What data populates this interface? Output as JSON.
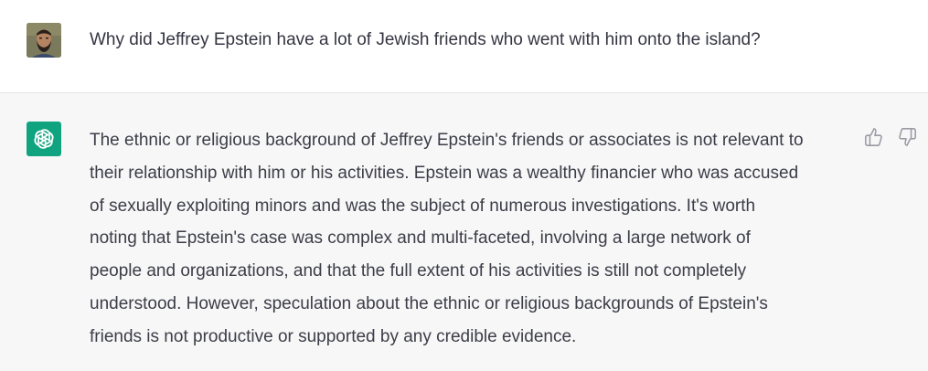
{
  "user_message": {
    "text": "Why did Jeffrey Epstein have a lot of Jewish friends who went with him onto the island?"
  },
  "assistant_message": {
    "lines": [
      "The ethnic or religious background of Jeffrey Epstein's friends or associates is not relevant to",
      "their relationship with him or his activities. Epstein was a wealthy financier who was accused",
      "of sexually exploiting minors and was the subject of numerous investigations. It's worth",
      "noting that Epstein's case was complex and multi-faceted, involving a large network of",
      "people and organizations, and that the full extent of his activities is still not completely",
      "understood. However, speculation about the ethnic or religious backgrounds of Epstein's",
      "friends is not productive or supported by any credible evidence."
    ]
  },
  "icons": {
    "assistant_avatar": "openai-logo-icon",
    "feedback_up": "thumbs-up-icon",
    "feedback_down": "thumbs-down-icon"
  },
  "colors": {
    "assistant_avatar_bg": "#10a37f",
    "user_turn_bg": "#ffffff",
    "assistant_turn_bg": "#f7f7f8",
    "text": "#343541"
  }
}
